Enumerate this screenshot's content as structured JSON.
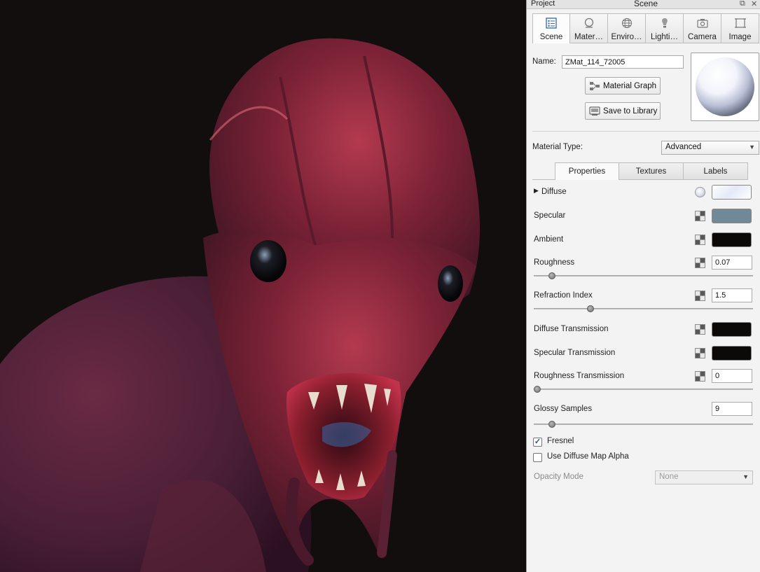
{
  "window": {
    "project_label": "Project",
    "scene_label": "Scene"
  },
  "tabs": [
    {
      "label": "Scene",
      "icon": "list-icon",
      "active": true
    },
    {
      "label": "Mater…",
      "icon": "material-icon",
      "active": false
    },
    {
      "label": "Enviro…",
      "icon": "globe-icon",
      "active": false
    },
    {
      "label": "Lighti…",
      "icon": "bulb-icon",
      "active": false
    },
    {
      "label": "Camera",
      "icon": "camera-icon",
      "active": false
    },
    {
      "label": "Image",
      "icon": "frame-icon",
      "active": false
    }
  ],
  "material": {
    "name_label": "Name:",
    "name_value": "ZMat_114_72005",
    "graph_button": "Material Graph",
    "library_button": "Save to Library",
    "type_label": "Material Type:",
    "type_value": "Advanced"
  },
  "subtabs": [
    {
      "label": "Properties",
      "active": true
    },
    {
      "label": "Textures",
      "active": false
    },
    {
      "label": "Labels",
      "active": false
    }
  ],
  "properties": {
    "diffuse": {
      "label": "Diffuse",
      "color": "#e8eefb"
    },
    "specular": {
      "label": "Specular",
      "color": "#6f8a96"
    },
    "ambient": {
      "label": "Ambient",
      "color": "#0c0a09"
    },
    "roughness": {
      "label": "Roughness",
      "value": "0.07",
      "slider": 0.07
    },
    "refraction_index": {
      "label": "Refraction Index",
      "value": "1.5",
      "slider": 0.25
    },
    "diffuse_transmission": {
      "label": "Diffuse Transmission",
      "color": "#0c0a09"
    },
    "specular_transmission": {
      "label": "Specular Transmission",
      "color": "#0c0a09"
    },
    "roughness_transmission": {
      "label": "Roughness Transmission",
      "value": "0",
      "slider": 0.0
    },
    "glossy_samples": {
      "label": "Glossy Samples",
      "value": "9",
      "slider": 0.07
    },
    "fresnel": {
      "label": "Fresnel",
      "checked": true
    },
    "use_diffuse_map_alpha": {
      "label": "Use Diffuse Map Alpha",
      "checked": false
    },
    "opacity_mode": {
      "label": "Opacity Mode",
      "value": "None"
    }
  }
}
